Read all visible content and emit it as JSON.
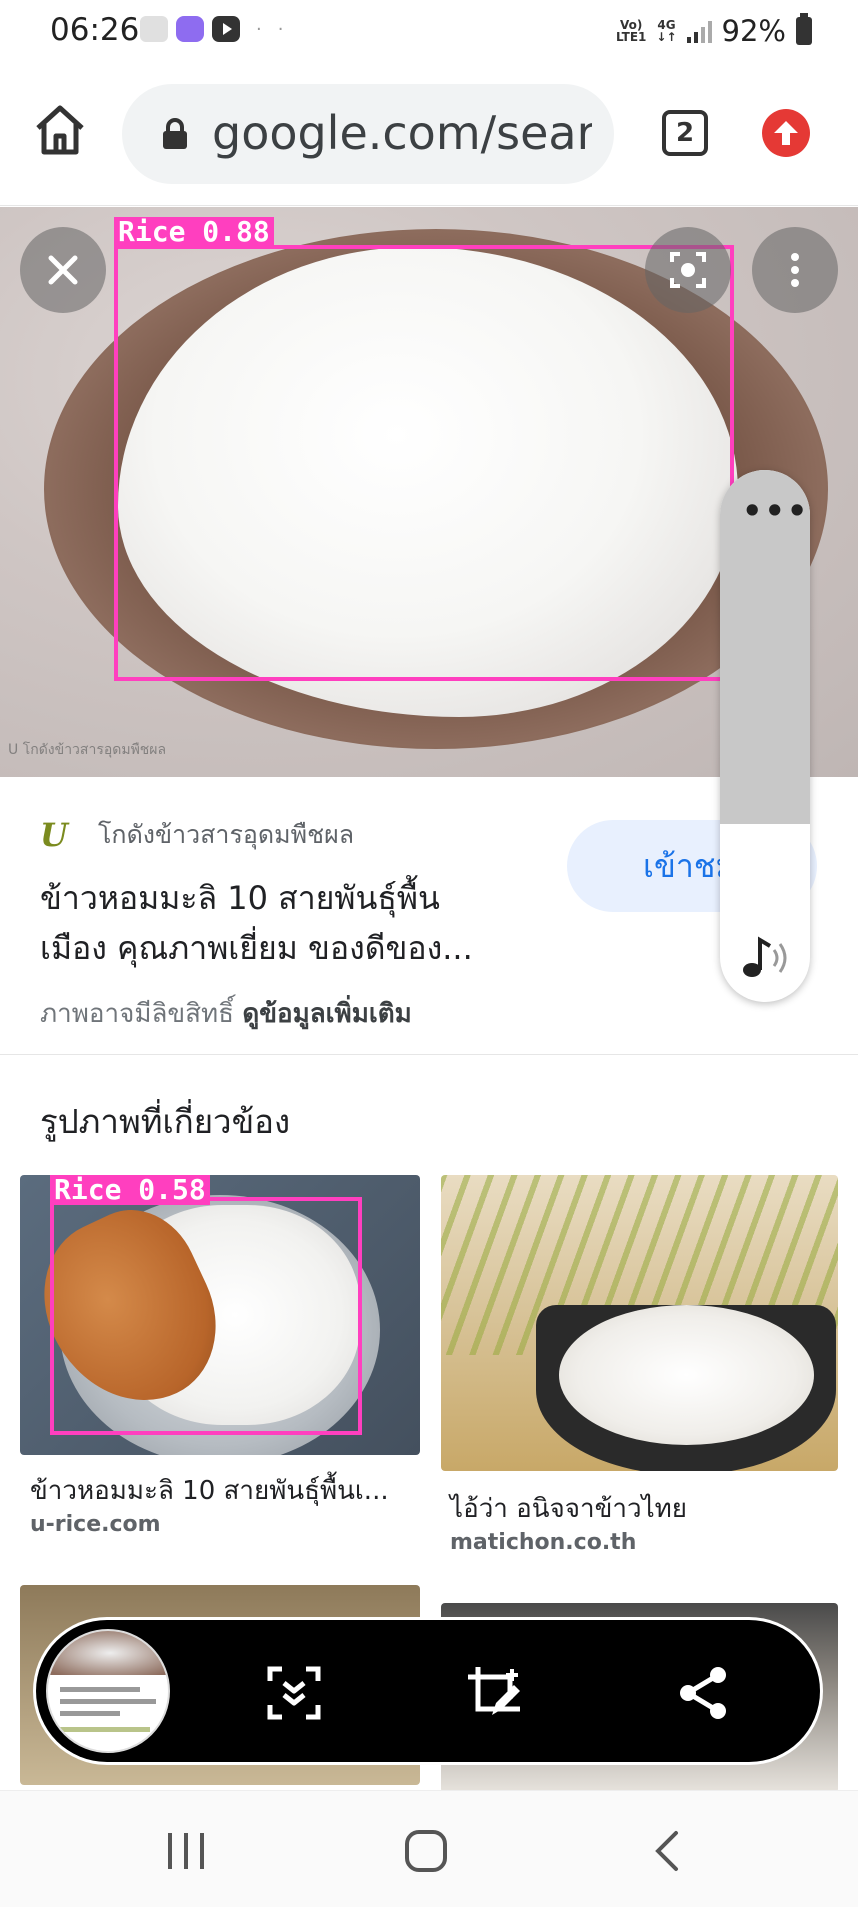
{
  "status_bar": {
    "time": "06:26",
    "volte_label_1": "Vo)",
    "volte_label_2": "LTE1",
    "network_label": "4G",
    "battery_percent": "92%",
    "icons": [
      "gallery-icon",
      "app-icon",
      "youtube-icon",
      "signal-icon",
      "battery-icon"
    ]
  },
  "browser": {
    "url": "google.com/search",
    "tab_count": "2",
    "icons": [
      "home-icon",
      "lock-icon",
      "tabs-icon",
      "update-icon"
    ]
  },
  "hero": {
    "watermark": "U โกดังข้าวสารอุดมพืชผล",
    "detection": {
      "label": "Rice",
      "score": "0.88"
    },
    "icons": [
      "close-icon",
      "lens-icon",
      "more-vertical-icon"
    ]
  },
  "side_panel": {
    "icons": [
      "more-horizontal-icon",
      "audio-note-icon"
    ]
  },
  "result": {
    "source_logo": "U",
    "source_name": "โกดังข้าวสารอุดมพืชผล",
    "visit_label": "เข้าชม",
    "title_line1": "ข้าวหอมมะลิ 10 สายพันธุ์พื้น",
    "title_line2": "เมือง คุณภาพเยี่ยม ของดีของ...",
    "copyright_text": "ภาพอาจมีลิขสิทธิ์",
    "more_info_link": "ดูข้อมูลเพิ่มเติม"
  },
  "related": {
    "section_title": "รูปภาพที่เกี่ยวข้อง",
    "items": [
      {
        "caption": "ข้าวหอมมะลิ 10 สายพันธุ์พื้นเ...",
        "domain": "u-rice.com",
        "detection": {
          "label": "Rice",
          "score": "0.58"
        }
      },
      {
        "caption": "ไอ้ว่า อนิจจาข้าวไทย",
        "domain": "matichon.co.th"
      }
    ]
  },
  "action_bar": {
    "icons": [
      "screenshot-thumbnail",
      "scroll-capture-icon",
      "crop-edit-icon",
      "share-icon"
    ]
  },
  "nav_bar": {
    "icons": [
      "recents-icon",
      "home-nav-icon",
      "back-icon"
    ]
  },
  "colors": {
    "detection_box": "#ff3fbf",
    "link_blue": "#1a73e8",
    "update_red": "#e53935"
  }
}
